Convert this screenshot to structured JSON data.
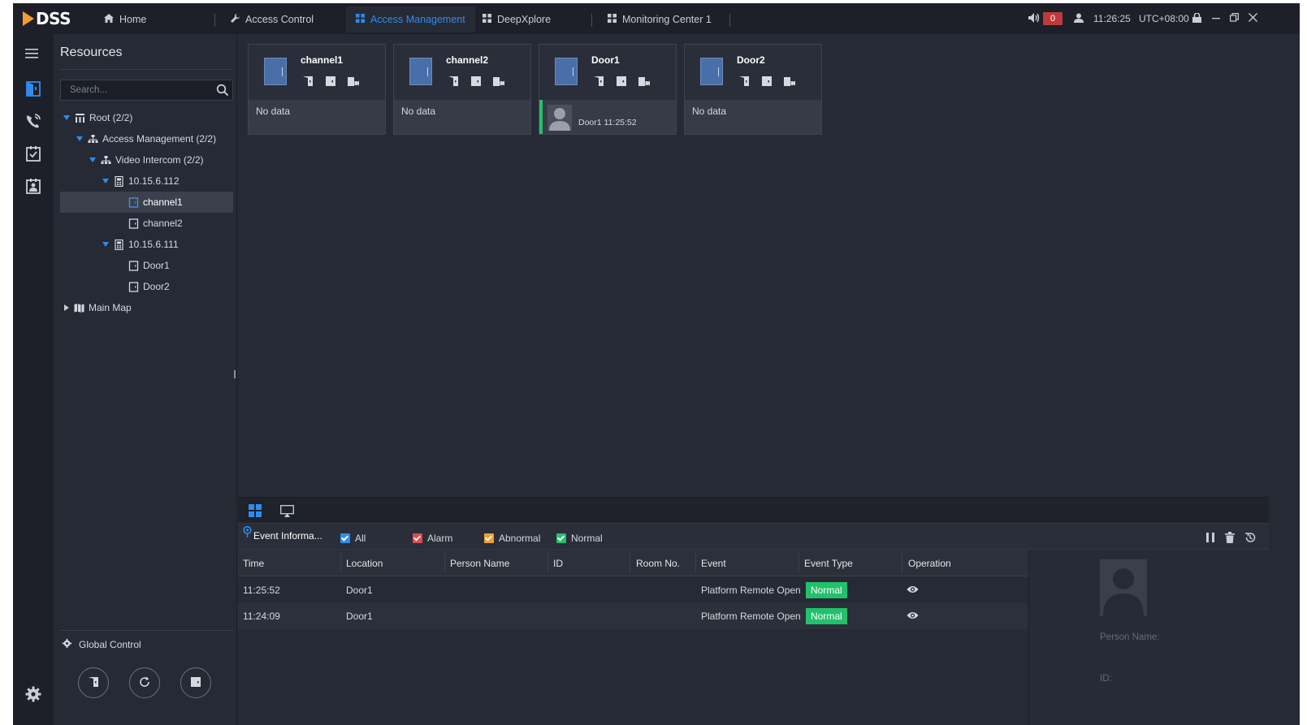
{
  "app": {
    "logo": "DSS",
    "tabs": [
      {
        "label": "Home",
        "icon": "home-icon",
        "active": false
      },
      {
        "label": "Access Control",
        "icon": "wrench-icon",
        "active": false
      },
      {
        "label": "Access Management",
        "icon": "grid-icon",
        "active": true
      },
      {
        "label": "DeepXplore",
        "icon": "grid-icon",
        "active": false
      },
      {
        "label": "Monitoring Center 1",
        "icon": "grid-icon",
        "active": false
      }
    ],
    "alarm_count": "0",
    "time": "11:26:25",
    "timezone": "UTC+08:00",
    "accent_color": "#2e8cf0"
  },
  "rail": {
    "items": [
      "menu-icon",
      "access-door-icon",
      "intercom-call-icon",
      "attendance-icon",
      "visitor-icon"
    ],
    "bottom": "settings-gear-icon"
  },
  "resources": {
    "title": "Resources",
    "search_placeholder": "Search...",
    "tree": [
      {
        "label": "Root (2/2)",
        "level": 0,
        "expanded": true,
        "icon": "org-root-icon"
      },
      {
        "label": "Access Management (2/2)",
        "level": 1,
        "expanded": true,
        "icon": "org-node-icon"
      },
      {
        "label": "Video Intercom (2/2)",
        "level": 2,
        "expanded": true,
        "icon": "org-node-icon"
      },
      {
        "label": "10.15.6.112",
        "level": 3,
        "expanded": true,
        "icon": "device-icon"
      },
      {
        "label": "channel1",
        "level": 4,
        "selected": true,
        "icon": "door-channel-icon"
      },
      {
        "label": "channel2",
        "level": 4,
        "icon": "door-channel-icon"
      },
      {
        "label": "10.15.6.111",
        "level": 3,
        "expanded": true,
        "icon": "device-icon"
      },
      {
        "label": "Door1",
        "level": 4,
        "icon": "door-channel-icon"
      },
      {
        "label": "Door2",
        "level": 4,
        "icon": "door-channel-icon"
      },
      {
        "label": "Main Map",
        "level": 0,
        "expanded": false,
        "icon": "map-icon"
      }
    ],
    "global_control": "Global Control"
  },
  "doors": [
    {
      "name": "channel1",
      "status": "No data"
    },
    {
      "name": "channel2",
      "status": "No data"
    },
    {
      "name": "Door1",
      "status": "",
      "event": "Door1 11:25:52"
    },
    {
      "name": "Door2",
      "status": "No data"
    }
  ],
  "events": {
    "tab_label": "Event Informa...",
    "filters": [
      {
        "label": "All",
        "color": "#2e8cf0",
        "checked": true
      },
      {
        "label": "Alarm",
        "color": "#e24a4a",
        "checked": true
      },
      {
        "label": "Abnormal",
        "color": "#f0a030",
        "checked": true
      },
      {
        "label": "Normal",
        "color": "#22c16b",
        "checked": true
      }
    ],
    "columns": [
      "Time",
      "Location",
      "Person Name",
      "ID",
      "Room No.",
      "Event",
      "Event Type",
      "Operation"
    ],
    "rows": [
      {
        "time": "11:25:52",
        "location": "Door1",
        "person": "",
        "id": "",
        "room": "",
        "event": "Platform Remote Open",
        "type": "Normal"
      },
      {
        "time": "11:24:09",
        "location": "Door1",
        "person": "",
        "id": "",
        "room": "",
        "event": "Platform Remote Open",
        "type": "Normal"
      }
    ],
    "detail": {
      "person_name_label": "Person Name:",
      "id_label": "ID:"
    }
  }
}
